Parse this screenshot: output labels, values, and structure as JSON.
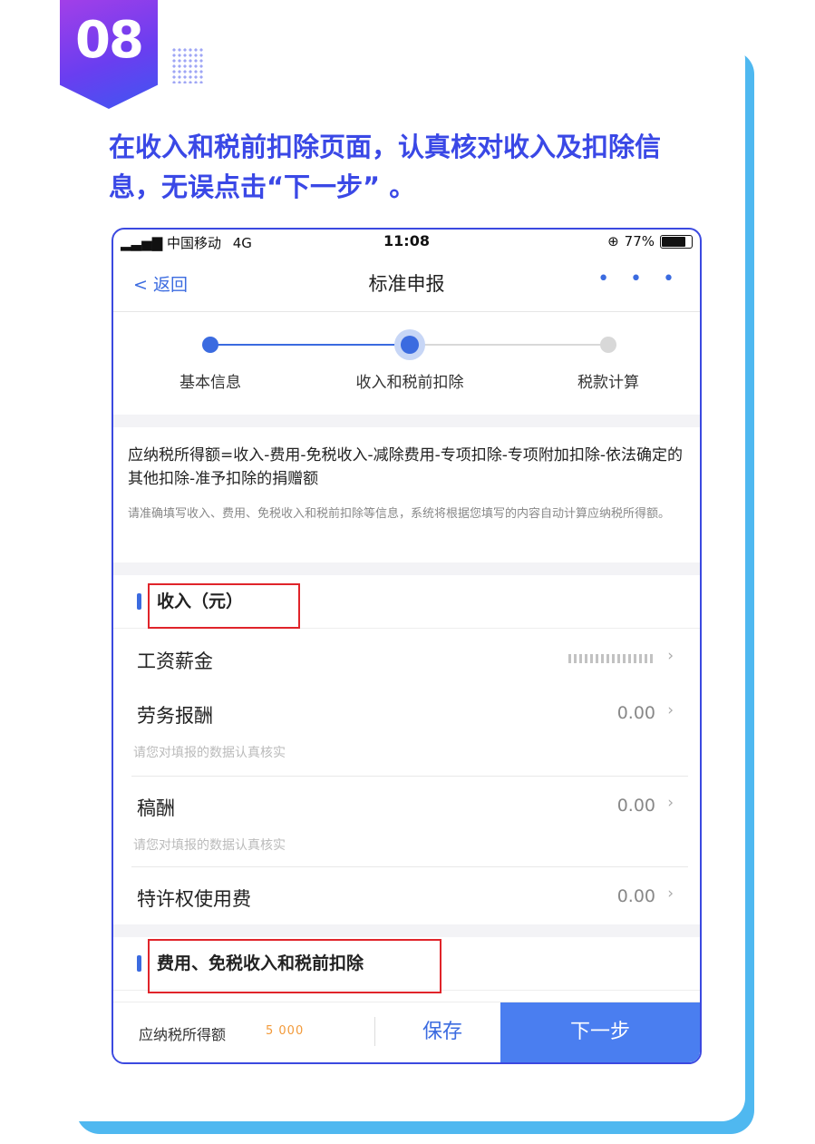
{
  "badge": {
    "number": "08"
  },
  "instruction": "在收入和税前扣除页面，认真核对收入及扣除信息，无误点击“下一步” 。",
  "status_bar": {
    "carrier": "中国移动",
    "network": "4G",
    "time": "11:08",
    "battery": "77%"
  },
  "nav": {
    "back_label": "返回",
    "title": "标准申报",
    "more": "• • •"
  },
  "steps": [
    {
      "label": "基本信息",
      "state": "done"
    },
    {
      "label": "收入和税前扣除",
      "state": "current"
    },
    {
      "label": "税款计算",
      "state": "pending"
    }
  ],
  "formula": "应纳税所得额=收入-费用-免税收入-减除费用-专项扣除-专项附加扣除-依法确定的其他扣除-准予扣除的捐赠额",
  "hint": "请准确填写收入、费用、免税收入和税前扣除等信息，系统将根据您填写的内容自动计算应纳税所得额。",
  "income_section": {
    "title": "收入（元）",
    "rows": [
      {
        "label": "工资薪金",
        "value": "",
        "note": ""
      },
      {
        "label": "劳务报酬",
        "value": "0.00",
        "note": "请您对填报的数据认真核实"
      },
      {
        "label": "稿酬",
        "value": "0.00",
        "note": "请您对填报的数据认真核实"
      },
      {
        "label": "特许权使用费",
        "value": "0.00",
        "note": ""
      }
    ]
  },
  "deduction_section": {
    "title": "费用、免税收入和税前扣除"
  },
  "bottom_bar": {
    "tax_label": "应纳税所得额",
    "tax_value": "5 000",
    "save_label": "保存",
    "next_label": "下一步"
  },
  "colors": {
    "accent": "#3b6be0",
    "instruction": "#3a48e6",
    "highlight": "#e0242a",
    "card_shadow": "#4fb8f0"
  }
}
